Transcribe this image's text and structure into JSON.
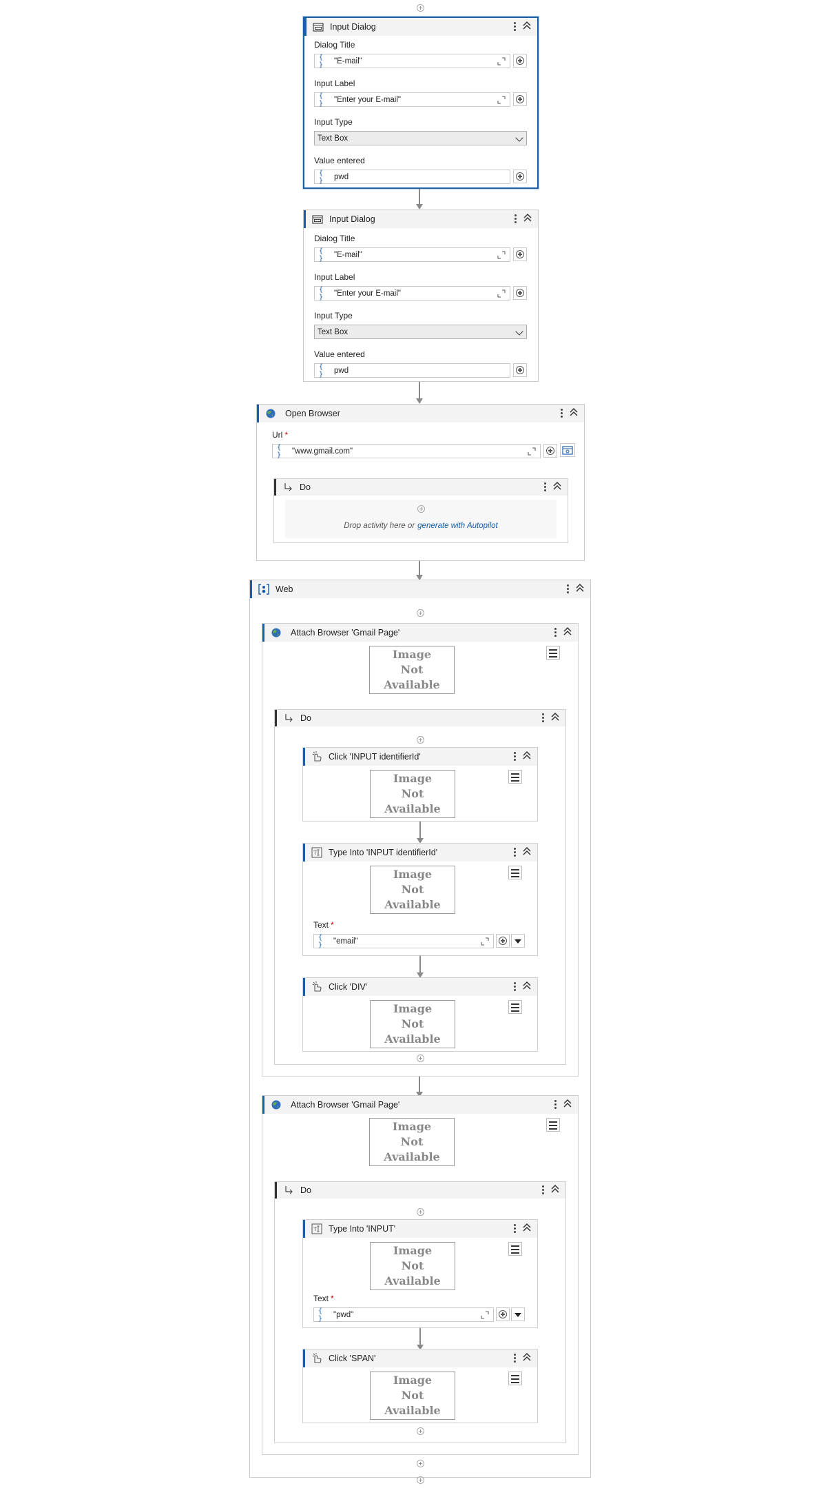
{
  "input_dialog_1": {
    "title": "Input Dialog",
    "dialog_title_label": "Dialog Title",
    "dialog_title_value": "\"E-mail\"",
    "input_label_label": "Input Label",
    "input_label_value": "\"Enter your E-mail\"",
    "input_type_label": "Input Type",
    "input_type_value": "Text Box",
    "value_entered_label": "Value entered",
    "value_entered_value": "pwd"
  },
  "input_dialog_2": {
    "title": "Input Dialog",
    "dialog_title_label": "Dialog Title",
    "dialog_title_value": "\"E-mail\"",
    "input_label_label": "Input Label",
    "input_label_value": "\"Enter your E-mail\"",
    "input_type_label": "Input Type",
    "input_type_value": "Text Box",
    "value_entered_label": "Value entered",
    "value_entered_value": "pwd"
  },
  "open_browser": {
    "title": "Open Browser",
    "url_label": "Url",
    "required_mark": "*",
    "url_value": "\"www.gmail.com\"",
    "do_label": "Do",
    "drop_text": "Drop activity here or",
    "drop_link": "generate with Autopilot"
  },
  "web": {
    "title": "Web",
    "attach_1": {
      "title": "Attach Browser 'Gmail Page'",
      "image_text": "Image Not Available",
      "do_label": "Do",
      "click_1": {
        "title": "Click 'INPUT  identifierId'",
        "image_text": "Image Not Available"
      },
      "type_1": {
        "title": "Type Into 'INPUT  identifierId'",
        "image_text": "Image Not Available",
        "text_label": "Text",
        "required_mark": "*",
        "text_value": "\"email\""
      },
      "click_2": {
        "title": "Click 'DIV'",
        "image_text": "Image Not Available"
      }
    },
    "attach_2": {
      "title": "Attach Browser 'Gmail Page'",
      "image_text": "Image Not Available",
      "do_label": "Do",
      "type_1": {
        "title": "Type Into 'INPUT'",
        "image_text": "Image Not Available",
        "text_label": "Text",
        "required_mark": "*",
        "text_value": "\"pwd\""
      },
      "click_1": {
        "title": "Click 'SPAN'",
        "image_text": "Image Not Available"
      }
    }
  },
  "colors": {
    "accent": "#1b5fa8",
    "header_bg": "#f3f3f3",
    "connector": "#8a8a8a"
  },
  "icons": [
    "dialog-icon",
    "browser-icon",
    "web-icon",
    "click-icon",
    "type-into-icon",
    "do-arrow-icon",
    "more-options-icon",
    "collapse-icon",
    "add-icon",
    "expand-icon",
    "selector-menu-icon"
  ]
}
